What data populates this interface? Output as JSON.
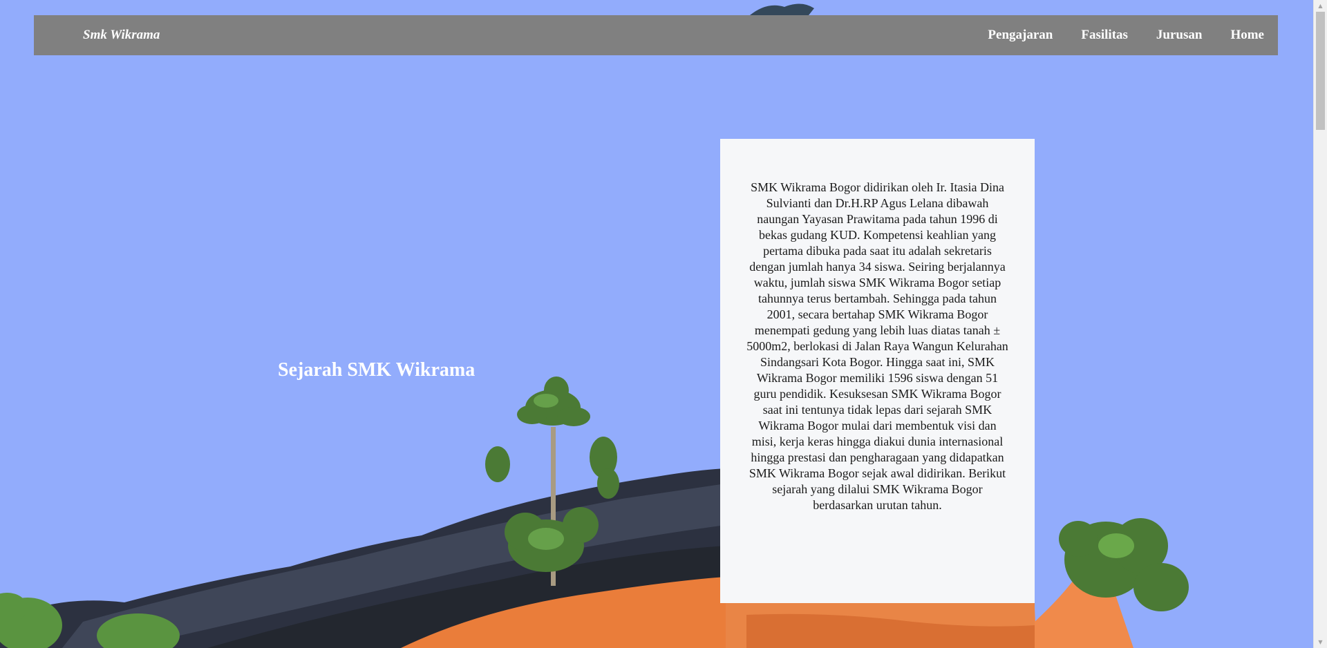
{
  "navbar": {
    "brand": "Smk Wikrama",
    "links": [
      "Pengajaran",
      "Fasilitas",
      "Jurusan",
      "Home"
    ]
  },
  "hero": {
    "title": "Sejarah SMK Wikrama"
  },
  "history": {
    "text": "SMK Wikrama Bogor didirikan oleh Ir. Itasia Dina Sulvianti dan Dr.H.RP Agus Lelana dibawah naungan Yayasan Prawitama pada tahun 1996 di bekas gudang KUD. Kompetensi keahlian yang pertama dibuka pada saat itu adalah sekretaris dengan jumlah hanya 34 siswa. Seiring berjalannya waktu, jumlah siswa SMK Wikrama Bogor setiap tahunnya terus bertambah. Sehingga pada tahun 2001, secara bertahap SMK Wikrama Bogor menempati gedung yang lebih luas diatas tanah ± 5000m2, berlokasi di Jalan Raya Wangun Kelurahan Sindangsari Kota Bogor. Hingga saat ini, SMK Wikrama Bogor memiliki 1596 siswa dengan 51 guru pendidik. Kesuksesan SMK Wikrama Bogor saat ini tentunya tidak lepas dari sejarah SMK Wikrama Bogor mulai dari membentuk visi dan misi, kerja keras hingga diakui dunia internasional hingga prestasi dan pengharagaan yang didapatkan SMK Wikrama Bogor sejak awal didirikan. Berikut sejarah yang dilalui SMK Wikrama Bogor berdasarkan urutan tahun."
  },
  "colors": {
    "sky": "#92acfc",
    "navbar": "#808080",
    "card": "#f6f7f9",
    "roof_tile": "#f08a4b",
    "dark_roof": "#2c3140"
  }
}
